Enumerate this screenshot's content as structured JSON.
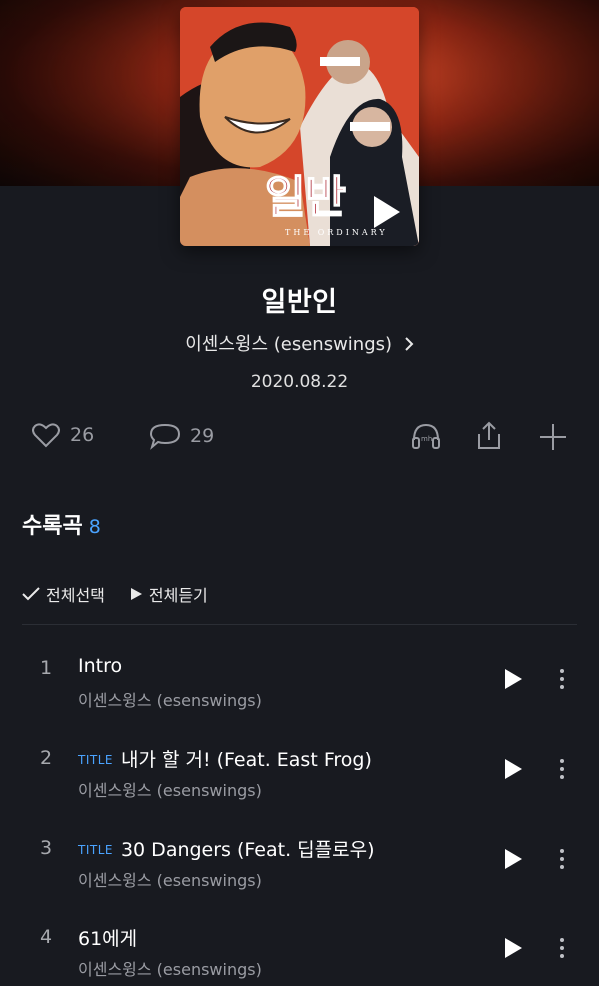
{
  "album": {
    "cover_text": "일반",
    "cover_subtext": "THE ORDINARY",
    "title": "일반인",
    "artist": "이센스윙스 (esenswings)",
    "date": "2020.08.22"
  },
  "actions": {
    "likes": "26",
    "comments": "29",
    "icons": [
      "heart-icon",
      "comment-icon",
      "headphones-mix-icon",
      "share-icon",
      "add-icon"
    ]
  },
  "tracklist": {
    "heading": "수록곡",
    "count": "8",
    "select_all": "전체선택",
    "play_all": "전체듣기",
    "tracks": [
      {
        "num": "1",
        "badge": "",
        "title": "Intro",
        "artist": "이센스윙스 (esenswings)"
      },
      {
        "num": "2",
        "badge": "TITLE",
        "title": "내가 할 거! (Feat. East Frog)",
        "artist": "이센스윙스 (esenswings)"
      },
      {
        "num": "3",
        "badge": "TITLE",
        "title": "30 Dangers (Feat. 딥플로우)",
        "artist": "이센스윙스 (esenswings)"
      },
      {
        "num": "4",
        "badge": "",
        "title": "61에게",
        "artist": "이센스윙스 (esenswings)"
      }
    ]
  },
  "colors": {
    "accent": "#4aa3ff",
    "background": "#181a20",
    "cover": "#d5462a"
  }
}
